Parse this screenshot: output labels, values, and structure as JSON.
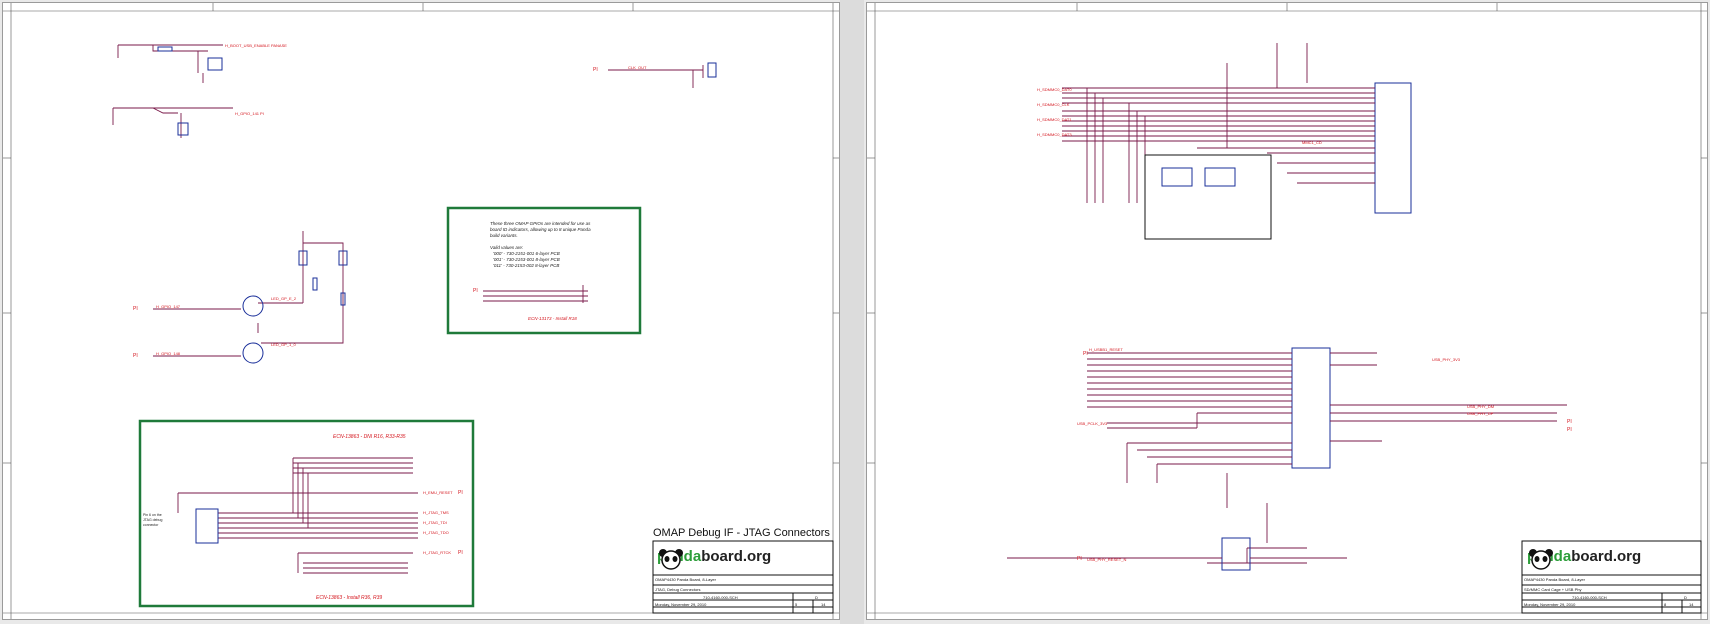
{
  "sheets": [
    {
      "title": "OMAP Debug IF - JTAG Connectors",
      "logo": {
        "prefix": "panda",
        "suffix": "board.org"
      },
      "titleblock": {
        "board": "OMAP4430 Panda Board, 8-Layer",
        "sheet_name": "JTAG, Debug Connectors",
        "doc_no": "710-4160-000-SCH",
        "rev": "D",
        "date": "Monday, November 29, 2010",
        "sheet": "5",
        "of": "14"
      },
      "notes": {
        "gpio_text": [
          "These three OMAP GPIOs are intended for use as",
          "board ID indicators, allowing up to 8 unique Panda",
          "build variants.",
          "",
          "Valid values are:",
          "'000' - 730-2151-001 6-layer PCB",
          "'001' - 730-2153-001 8-layer PCB",
          "'011' - 730-2153-002 8-layer PCB"
        ],
        "eco_install_r18": "ECN-13173 - Install R18",
        "eco_dni": "ECN-13863 - DNI R16, R33-R35",
        "eco_install": "ECN-13863 - Install R36, R39"
      }
    },
    {
      "logo": {
        "prefix": "panda",
        "suffix": "board.org"
      },
      "titleblock": {
        "board": "OMAP4430 Panda Board, 8-Layer",
        "sheet_name": "SD/MMC Card Cage + USB Phy",
        "doc_no": "710-4160-000-SCH",
        "rev": "D",
        "date": "Monday, November 29, 2010",
        "sheet": "8",
        "of": "14"
      }
    }
  ],
  "colors": {
    "net": "#d4141c",
    "component": "#1a2f9a",
    "frame_note": "#1f7a3a",
    "wire": "#7a1a4a"
  }
}
